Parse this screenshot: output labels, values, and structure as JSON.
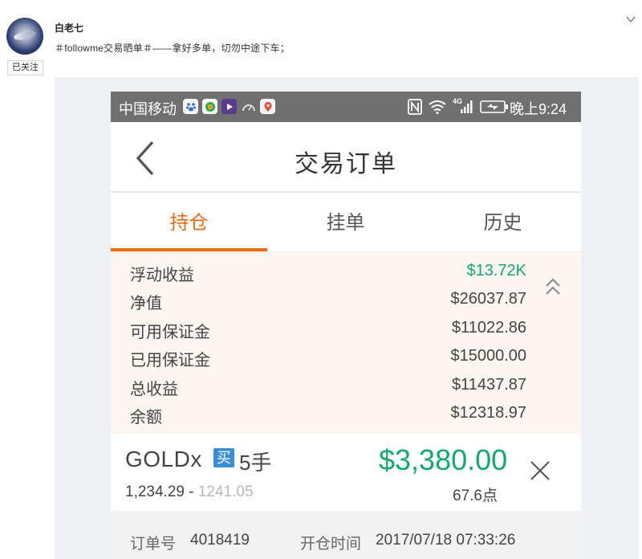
{
  "post": {
    "username": "白老七",
    "follow_label": "已关注",
    "text": "＃followme交易晒单＃——拿好多单，切勿中途下车；"
  },
  "phone": {
    "statusbar": {
      "carrier": "中国移动",
      "network": "4G",
      "time": "晚上9:24"
    },
    "title": "交易订单",
    "tabs": [
      {
        "label": "持仓"
      },
      {
        "label": "挂单"
      },
      {
        "label": "历史"
      }
    ],
    "summary": [
      {
        "label": "浮动收益",
        "value": "$13.72K"
      },
      {
        "label": "净值",
        "value": "$26037.87"
      },
      {
        "label": "可用保证金",
        "value": "$11022.86"
      },
      {
        "label": "已用保证金",
        "value": "$15000.00"
      },
      {
        "label": "总收益",
        "value": "$11437.87"
      },
      {
        "label": "余额",
        "value": "$12318.97"
      }
    ],
    "order": {
      "symbol": "GOLDx",
      "direction": "买",
      "lots": "5手",
      "profit": "$3,380.00",
      "open_price": "1,234.29",
      "separator": " - ",
      "current_price": "1241.05",
      "points": "67.6点"
    },
    "detail": {
      "order_no_label": "订单号",
      "order_no": "4018419",
      "open_time_label": "开仓时间",
      "open_time": "2017/07/18 07:33:26"
    }
  },
  "colors": {
    "accent_orange": "#ec6a12",
    "profit_green": "#13a870",
    "buy_blue": "#3a8ed6",
    "statusbar_gray": "#707070",
    "summary_bg": "#fdf6ef"
  }
}
